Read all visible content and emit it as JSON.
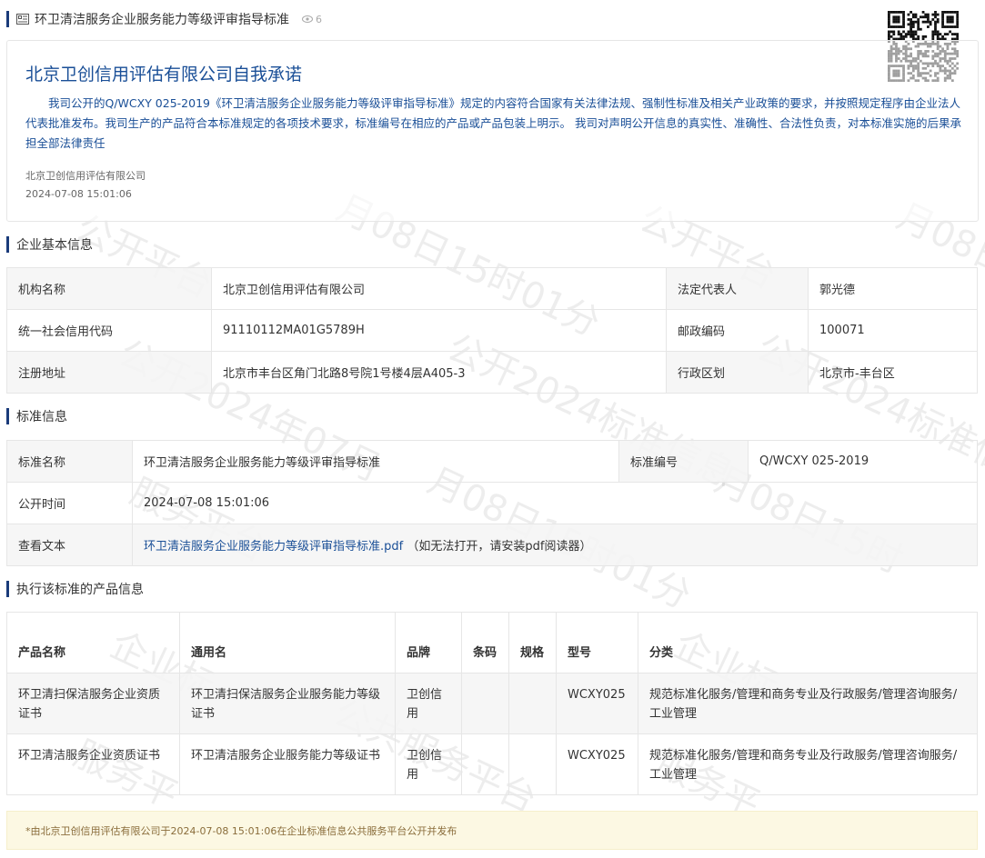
{
  "header": {
    "title": "环卫清洁服务企业服务能力等级评审指导标准",
    "views": "6"
  },
  "commitment": {
    "title": "北京卫创信用评估有限公司自我承诺",
    "text": "我司公开的Q/WCXY 025-2019《环卫清洁服务企业服务能力等级评审指导标准》规定的内容符合国家有关法律法规、强制性标准及相关产业政策的要求，并按照规定程序由企业法人代表批准发布。我司生产的产品符合本标准规定的各项技术要求，标准编号在相应的产品或产品包装上明示。 我司对声明公开信息的真实性、准确性、合法性负责，对本标准实施的后果承担全部法律责任",
    "company": "北京卫创信用评估有限公司",
    "time": "2024-07-08 15:01:06"
  },
  "basic_info": {
    "section_title": "企业基本信息",
    "org_name_label": "机构名称",
    "org_name": "北京卫创信用评估有限公司",
    "legal_rep_label": "法定代表人",
    "legal_rep": "郭光德",
    "credit_code_label": "统一社会信用代码",
    "credit_code": "91110112MA01G5789H",
    "postal_label": "邮政编码",
    "postal": "100071",
    "address_label": "注册地址",
    "address": "北京市丰台区角门北路8号院1号楼4层A405-3",
    "district_label": "行政区划",
    "district": "北京市-丰台区"
  },
  "standard_info": {
    "section_title": "标准信息",
    "name_label": "标准名称",
    "name": "环卫清洁服务企业服务能力等级评审指导标准",
    "number_label": "标准编号",
    "number": "Q/WCXY 025-2019",
    "publish_label": "公开时间",
    "publish_time": "2024-07-08 15:01:06",
    "view_label": "查看文本",
    "file_link": "环卫清洁服务企业服务能力等级评审指导标准.pdf",
    "file_note": "（如无法打开，请安装pdf阅读器）"
  },
  "products": {
    "section_title": "执行该标准的产品信息",
    "columns": [
      "产品名称",
      "通用名",
      "品牌",
      "条码",
      "规格",
      "型号",
      "分类"
    ],
    "rows": [
      [
        "环卫清扫保洁服务企业资质证书",
        "环卫清扫保洁服务企业服务能力等级证书",
        "卫创信用",
        "",
        "",
        "WCXY025",
        "规范标准化服务/管理和商务专业及行政服务/管理咨询服务/工业管理"
      ],
      [
        "环卫清洁服务企业资质证书",
        "环卫清洁服务企业服务能力等级证书",
        "卫创信用",
        "",
        "",
        "WCXY025",
        "规范标准化服务/管理和商务专业及行政服务/管理咨询服务/工业管理"
      ]
    ]
  },
  "footer": {
    "note": "*由北京卫创信用评估有限公司于2024-07-08 15:01:06在企业标准信息公共服务平台公开并发布"
  },
  "colors": {
    "accent_blue": "#1a4f97",
    "section_bar": "#1a3b7a",
    "footer_bg": "#fcf8e3",
    "footer_text": "#8a6d3b"
  }
}
